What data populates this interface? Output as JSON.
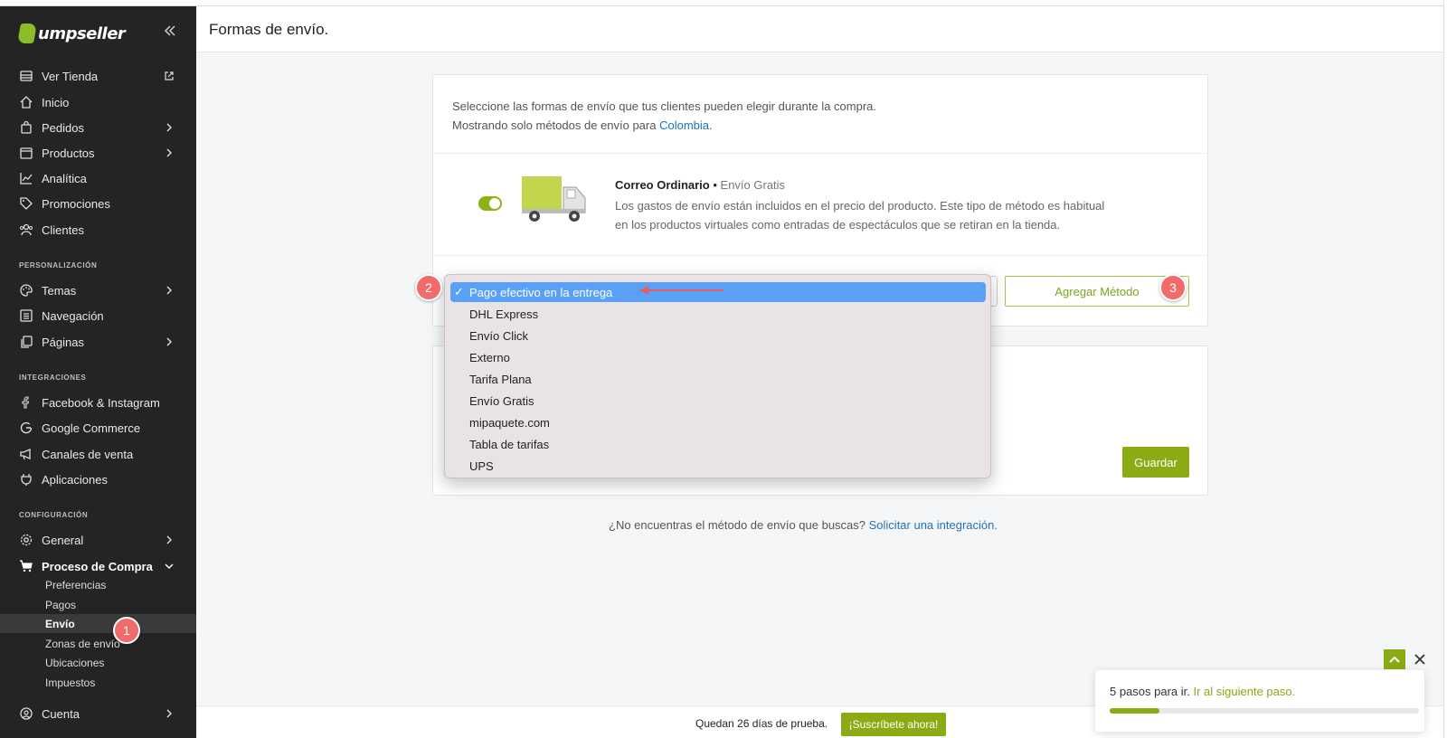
{
  "app": {
    "logo_text": "umpseller",
    "brand_color": "#8cbc28"
  },
  "header": {
    "title": "Formas de envío."
  },
  "sidebar": {
    "items": [
      {
        "label": "Ver Tienda",
        "icon": "store-icon"
      },
      {
        "label": "Inicio",
        "icon": "home-icon"
      },
      {
        "label": "Pedidos",
        "icon": "bag-icon"
      },
      {
        "label": "Productos",
        "icon": "box-icon"
      },
      {
        "label": "Analítica",
        "icon": "chart-icon"
      },
      {
        "label": "Promociones",
        "icon": "tag-icon"
      },
      {
        "label": "Clientes",
        "icon": "users-icon"
      }
    ],
    "section_personalizacion": "PERSONALIZACIÓN",
    "personalizacion": [
      {
        "label": "Temas",
        "icon": "palette-icon"
      },
      {
        "label": "Navegación",
        "icon": "list-icon"
      },
      {
        "label": "Páginas",
        "icon": "pages-icon"
      }
    ],
    "section_integraciones": "INTEGRACIONES",
    "integraciones": [
      {
        "label": "Facebook & Instagram",
        "icon": "facebook-icon"
      },
      {
        "label": "Google Commerce",
        "icon": "google-icon"
      },
      {
        "label": "Canales de venta",
        "icon": "megaphone-icon"
      },
      {
        "label": "Aplicaciones",
        "icon": "plug-icon"
      }
    ],
    "section_configuracion": "CONFIGURACIÓN",
    "configuracion": [
      {
        "label": "General",
        "icon": "gear-icon"
      },
      {
        "label": "Proceso de Compra",
        "icon": "cart-icon"
      }
    ],
    "sub_items": [
      "Preferencias",
      "Pagos",
      "Envío",
      "Zonas de envío",
      "Ubicaciones",
      "Impuestos"
    ],
    "cuenta": {
      "label": "Cuenta",
      "icon": "user-circle-icon"
    }
  },
  "main": {
    "intro_line1": "Seleccione las formas de envío que tus clientes pueden elegir durante la compra.",
    "intro_line2_prefix": "Mostrando solo métodos de envío para ",
    "intro_country": "Colombia",
    "intro_line2_suffix": ".",
    "shipping": {
      "name": "Correo Ordinario",
      "separator": " • ",
      "type": "Envío Gratis",
      "desc_line1": "Los gastos de envío están incluidos en el precio del producto. Este tipo de método es habitual",
      "desc_line2": "en los productos virtuales como entradas de espectáculos que se retiran en la tienda.",
      "enabled": true
    },
    "add_button": "Agregar Método",
    "save_button": "Guardar",
    "missing_text": "¿No encuentras el método de envío que buscas? ",
    "missing_link": "Solicitar una integración."
  },
  "dropdown": {
    "selected": "Pago efectivo en la entrega",
    "options": [
      "Pago efectivo en la entrega",
      "DHL Express",
      "Envío Click",
      "Externo",
      "Tarifa Plana",
      "Envío Gratis",
      "mipaquete.com",
      "Tabla de tarifas",
      "UPS"
    ]
  },
  "badges": [
    "1",
    "2",
    "3"
  ],
  "trial": {
    "text": "Quedan 26 días de prueba.",
    "button": "¡Suscríbete ahora!"
  },
  "steps": {
    "text": "5 pasos para ir. ",
    "link": "Ir al siguiente paso.",
    "progress": 0.16
  }
}
